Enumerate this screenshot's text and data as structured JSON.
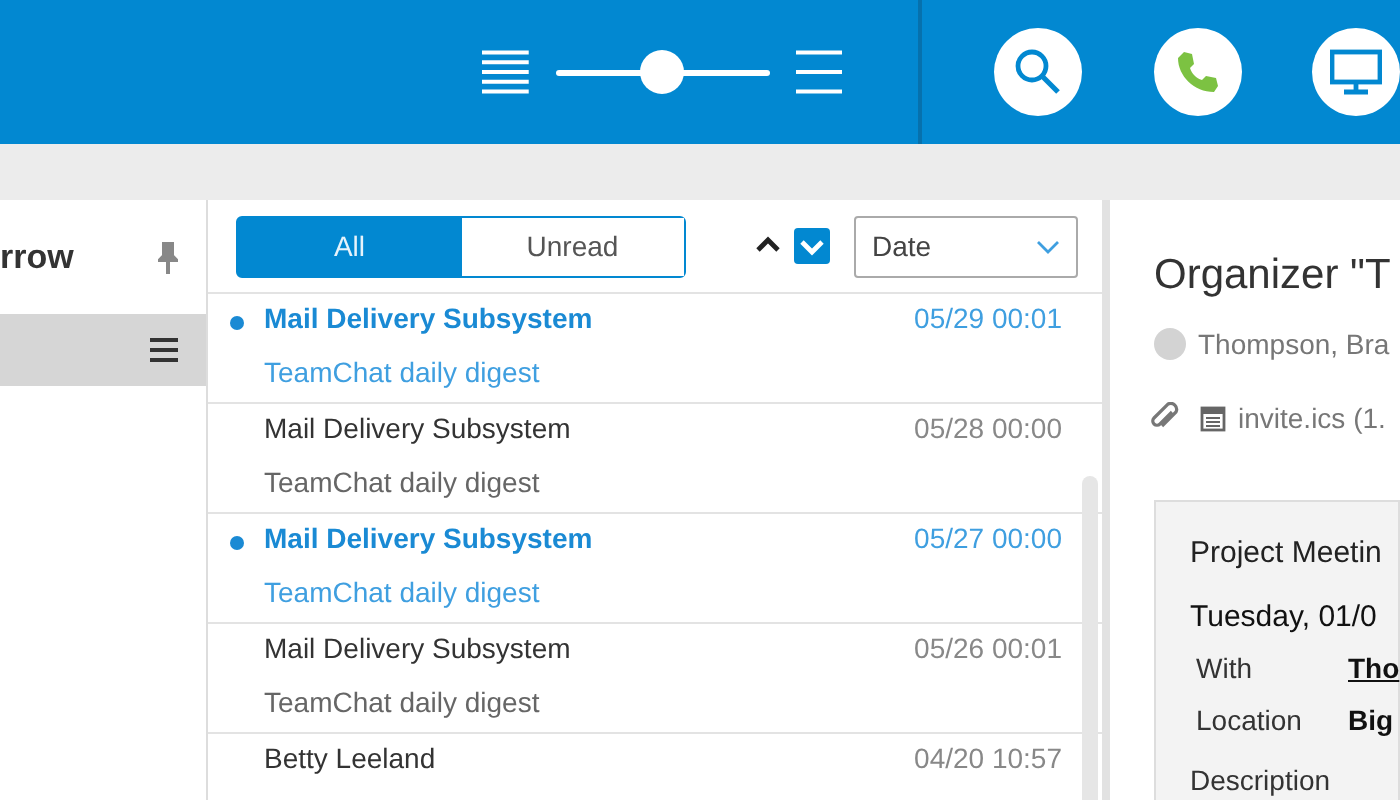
{
  "header": {
    "density_slider": {
      "level": 0.5
    }
  },
  "sidebar": {
    "title": "rrow",
    "items": [
      {
        "selected": true
      }
    ]
  },
  "message_list": {
    "filters": [
      {
        "label": "All",
        "selected": true
      },
      {
        "label": "Unread",
        "selected": false
      }
    ],
    "sort": {
      "field": "Date",
      "descending": true
    },
    "messages": [
      {
        "sender": "Mail Delivery Subsystem",
        "subject": "TeamChat daily digest",
        "time": "05/29 00:01",
        "unread": true
      },
      {
        "sender": "Mail Delivery Subsystem",
        "subject": "TeamChat daily digest",
        "time": "05/28 00:00",
        "unread": false
      },
      {
        "sender": "Mail Delivery Subsystem",
        "subject": "TeamChat daily digest",
        "time": "05/27 00:00",
        "unread": true
      },
      {
        "sender": "Mail Delivery Subsystem",
        "subject": "TeamChat daily digest",
        "time": "05/26 00:01",
        "unread": false
      },
      {
        "sender": "Betty Leeland",
        "time": "04/20 10:57",
        "unread": false
      }
    ]
  },
  "detail": {
    "title": "Organizer \"T",
    "from": "Thompson, Bra",
    "attachment": "invite.ics (1.",
    "invite": {
      "title": "Project Meetin",
      "date": "Tuesday, 01/0",
      "fields": [
        {
          "label": "With",
          "value": "Tho",
          "kind": "link"
        },
        {
          "label": "Location",
          "value": "Big",
          "kind": "text"
        }
      ],
      "description_label": "Description"
    }
  }
}
